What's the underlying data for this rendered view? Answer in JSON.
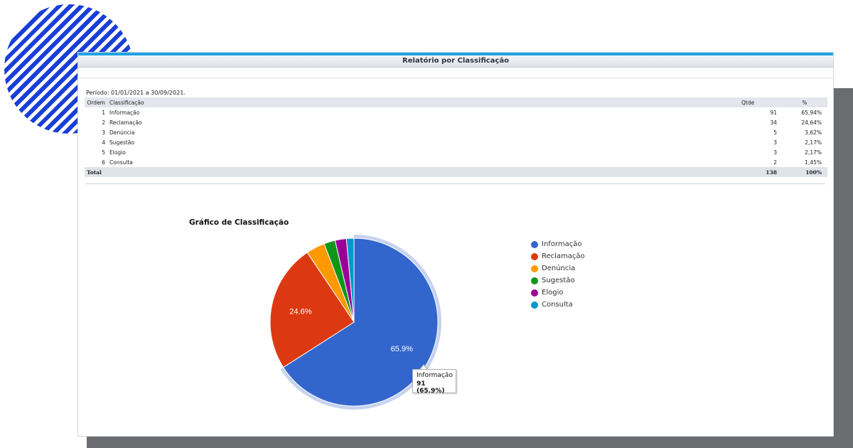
{
  "report": {
    "title": "Relatório por Classificação",
    "period": "Período: 01/01/2021 a 30/09/2021.",
    "columns": {
      "ordem": "Ordem",
      "classificacao": "Classificação",
      "qtde": "Qtde",
      "pct": "%"
    },
    "rows": [
      {
        "ordem": "1",
        "classificacao": "Informação",
        "qtde": "91",
        "pct": "65,94%"
      },
      {
        "ordem": "2",
        "classificacao": "Reclamação",
        "qtde": "34",
        "pct": "24,64%"
      },
      {
        "ordem": "3",
        "classificacao": "Denúncia",
        "qtde": "5",
        "pct": "3,62%"
      },
      {
        "ordem": "4",
        "classificacao": "Sugestão",
        "qtde": "3",
        "pct": "2,17%"
      },
      {
        "ordem": "5",
        "classificacao": "Elogio",
        "qtde": "3",
        "pct": "2,17%"
      },
      {
        "ordem": "6",
        "classificacao": "Consulta",
        "qtde": "2",
        "pct": "1,45%"
      }
    ],
    "total": {
      "label": "Total",
      "qtde": "138",
      "pct": "100%"
    }
  },
  "chart_data": {
    "type": "pie",
    "title": "Gráfico de Classificação",
    "categories": [
      "Informação",
      "Reclamação",
      "Denúncia",
      "Sugestão",
      "Elogio",
      "Consulta"
    ],
    "values": [
      91,
      34,
      5,
      3,
      3,
      2
    ],
    "colors": [
      "#3366cc",
      "#dc3912",
      "#ff9900",
      "#109618",
      "#990099",
      "#0099c6"
    ],
    "slice_labels": [
      "65.9%",
      "24.6%",
      "",
      "",
      "",
      ""
    ],
    "legend_position": "right",
    "highlighted_slice": "Informação"
  },
  "tooltip": {
    "label": "Informação",
    "value": "91 (65.9%)"
  },
  "theme": {
    "accent": "#1fa3e3",
    "decor": "#1a3fd6",
    "shadow": "#6b6c70"
  }
}
